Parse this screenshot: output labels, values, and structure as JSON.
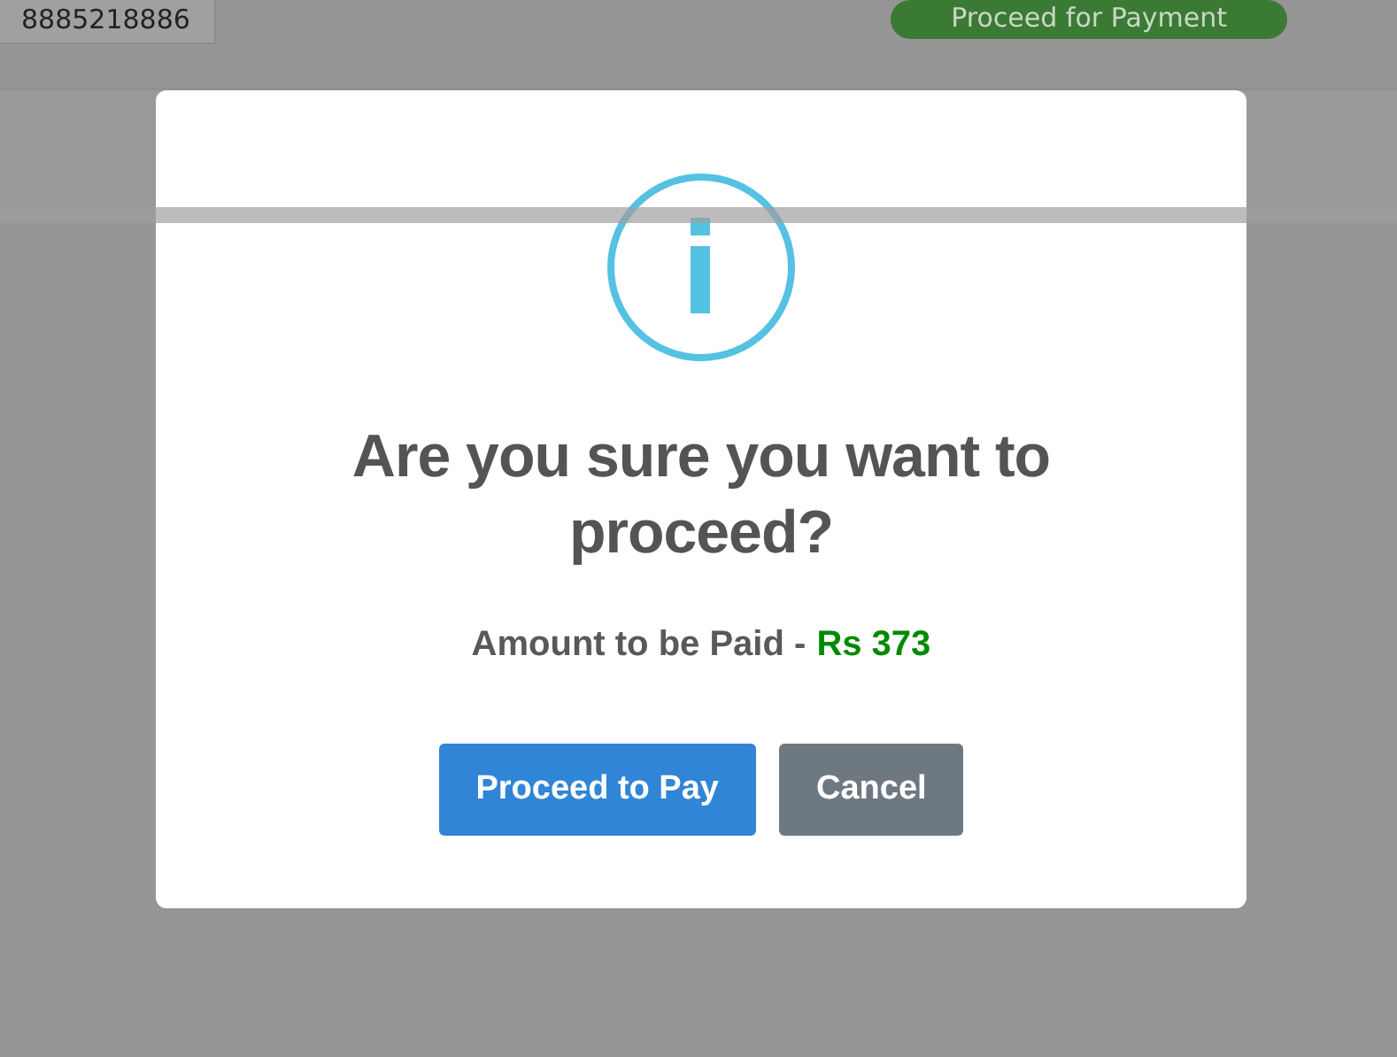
{
  "background": {
    "phone": "8885218886",
    "payment_button": "Proceed for Payment"
  },
  "dialog": {
    "title": "Are you sure you want to proceed?",
    "message": "Amount to be Paid -",
    "amount": "Rs 373",
    "buttons": [
      {
        "label": "Proceed to Pay",
        "kind": "confirm"
      },
      {
        "label": "Cancel",
        "kind": "cancel"
      }
    ]
  }
}
